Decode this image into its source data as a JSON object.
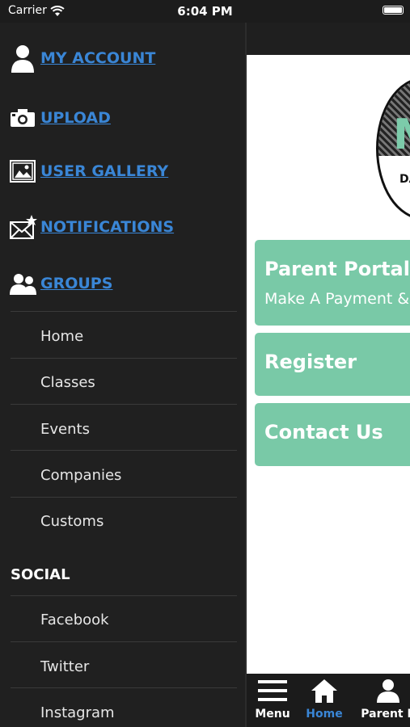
{
  "status": {
    "carrier": "Carrier",
    "time": "6:04 PM"
  },
  "account_menu": [
    {
      "label": "MY ACCOUNT",
      "icon": "user-icon"
    },
    {
      "label": "UPLOAD",
      "icon": "camera-icon"
    },
    {
      "label": "USER GALLERY",
      "icon": "gallery-icon"
    },
    {
      "label": "NOTIFICATIONS",
      "icon": "envelope-star-icon"
    },
    {
      "label": "GROUPS",
      "icon": "group-icon"
    }
  ],
  "nav_items": [
    "Home",
    "Classes",
    "Events",
    "Companies",
    "Customs"
  ],
  "social": {
    "title": "SOCIAL",
    "items": [
      "Facebook",
      "Twitter",
      "Instagram"
    ]
  },
  "logo": {
    "letter": "M",
    "sub": "DA"
  },
  "buttons": {
    "parent_portal": {
      "title": "Parent Portal",
      "subtitle": "Make A Payment &"
    },
    "register": {
      "title": "Register"
    },
    "contact": {
      "title": "Contact Us"
    }
  },
  "tabs": [
    {
      "label": "Menu",
      "icon": "hamburger-icon",
      "active": false
    },
    {
      "label": "Home",
      "icon": "home-icon",
      "active": true
    },
    {
      "label": "Parent P",
      "icon": "user-icon",
      "active": false
    }
  ],
  "colors": {
    "link": "#3a86d6",
    "accent": "#79c9a7",
    "menu_bg": "#202020"
  }
}
